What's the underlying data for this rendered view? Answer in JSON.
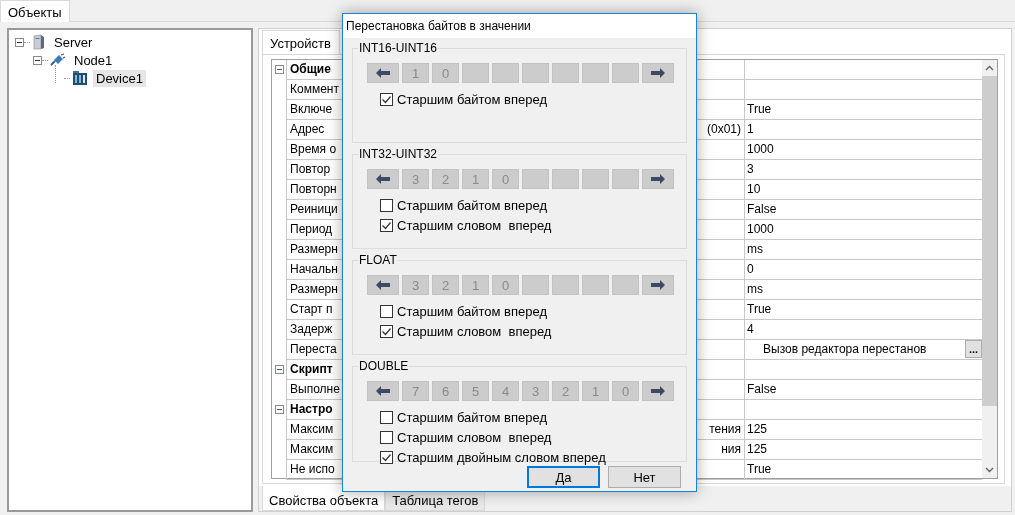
{
  "tabs": [
    {
      "label": "Объекты",
      "selected": true
    }
  ],
  "tree": [
    {
      "label": "Server",
      "kind": "server",
      "expanded": true,
      "selected": false,
      "children": [
        {
          "label": "Node1",
          "kind": "node",
          "expanded": true,
          "selected": false,
          "children": [
            {
              "label": "Device1",
              "kind": "device",
              "selected": true
            }
          ]
        }
      ]
    }
  ],
  "panel_tab": {
    "label": "Устройств"
  },
  "properties": [
    {
      "kind": "category",
      "name": "Общие",
      "expanded": true
    },
    {
      "kind": "property",
      "name": "Коммент"
    },
    {
      "kind": "property",
      "name": "Включе",
      "value": "True"
    },
    {
      "kind": "property",
      "name": "Адрес",
      "name_end": "(0x01)",
      "value": "1"
    },
    {
      "kind": "property",
      "name": "Время о",
      "value": "1000"
    },
    {
      "kind": "property",
      "name": "Повтор",
      "value": "3"
    },
    {
      "kind": "property",
      "name": "Повторн",
      "value": "10"
    },
    {
      "kind": "property",
      "name": "Реиници",
      "value": "False"
    },
    {
      "kind": "property",
      "name": "Период",
      "value": "1000"
    },
    {
      "kind": "property",
      "name": "Размерн",
      "value": "ms"
    },
    {
      "kind": "property",
      "name": "Начальн",
      "value": "0"
    },
    {
      "kind": "property",
      "name": "Размерн",
      "value": "ms"
    },
    {
      "kind": "property",
      "name": "Старт п",
      "value": "True"
    },
    {
      "kind": "property",
      "name": "Задерж",
      "value": "4"
    },
    {
      "kind": "editor",
      "name": "Переста",
      "value": "Вызов редактора перестанов",
      "button": "..."
    },
    {
      "kind": "category",
      "name": "Скрипт",
      "expanded": true
    },
    {
      "kind": "property",
      "name": "Выполне",
      "value": "False"
    },
    {
      "kind": "category",
      "name": "Настро",
      "expanded": true
    },
    {
      "kind": "property",
      "name": "Максим",
      "name_end": "тения",
      "value": "125"
    },
    {
      "kind": "property",
      "name": "Максим",
      "name_end": "ния",
      "value": "125"
    },
    {
      "kind": "property",
      "name": "Не испо",
      "value": "True"
    }
  ],
  "bottom_tabs": [
    {
      "label": "Свойства объекта",
      "selected": true
    },
    {
      "label": "Таблица тегов",
      "selected": false
    }
  ],
  "dialog": {
    "title": "Перестановка байтов в значении",
    "groups": [
      {
        "title": "INT16-UINT16",
        "bytes": [
          "1",
          "0"
        ],
        "options": [
          {
            "label": "Старшим байтом вперед",
            "checked": true
          }
        ]
      },
      {
        "title": "INT32-UINT32",
        "bytes": [
          "3",
          "2",
          "1",
          "0"
        ],
        "options": [
          {
            "label": "Старшим байтом вперед",
            "checked": false
          },
          {
            "label": "Старшим словом  вперед",
            "checked": true
          }
        ]
      },
      {
        "title": "FLOAT",
        "bytes": [
          "3",
          "2",
          "1",
          "0"
        ],
        "options": [
          {
            "label": "Старшим байтом вперед",
            "checked": false
          },
          {
            "label": "Старшим словом  вперед",
            "checked": true
          }
        ]
      },
      {
        "title": "DOUBLE",
        "bytes": [
          "7",
          "6",
          "5",
          "4",
          "3",
          "2",
          "1",
          "0"
        ],
        "options": [
          {
            "label": "Старшим байтом вперед",
            "checked": false
          },
          {
            "label": "Старшим словом  вперед",
            "checked": false
          },
          {
            "label": "Старшим двойным словом вперед",
            "checked": true
          }
        ]
      }
    ],
    "buttons": [
      {
        "label": "Да",
        "focused": true
      },
      {
        "label": "Нет",
        "focused": false
      }
    ]
  }
}
